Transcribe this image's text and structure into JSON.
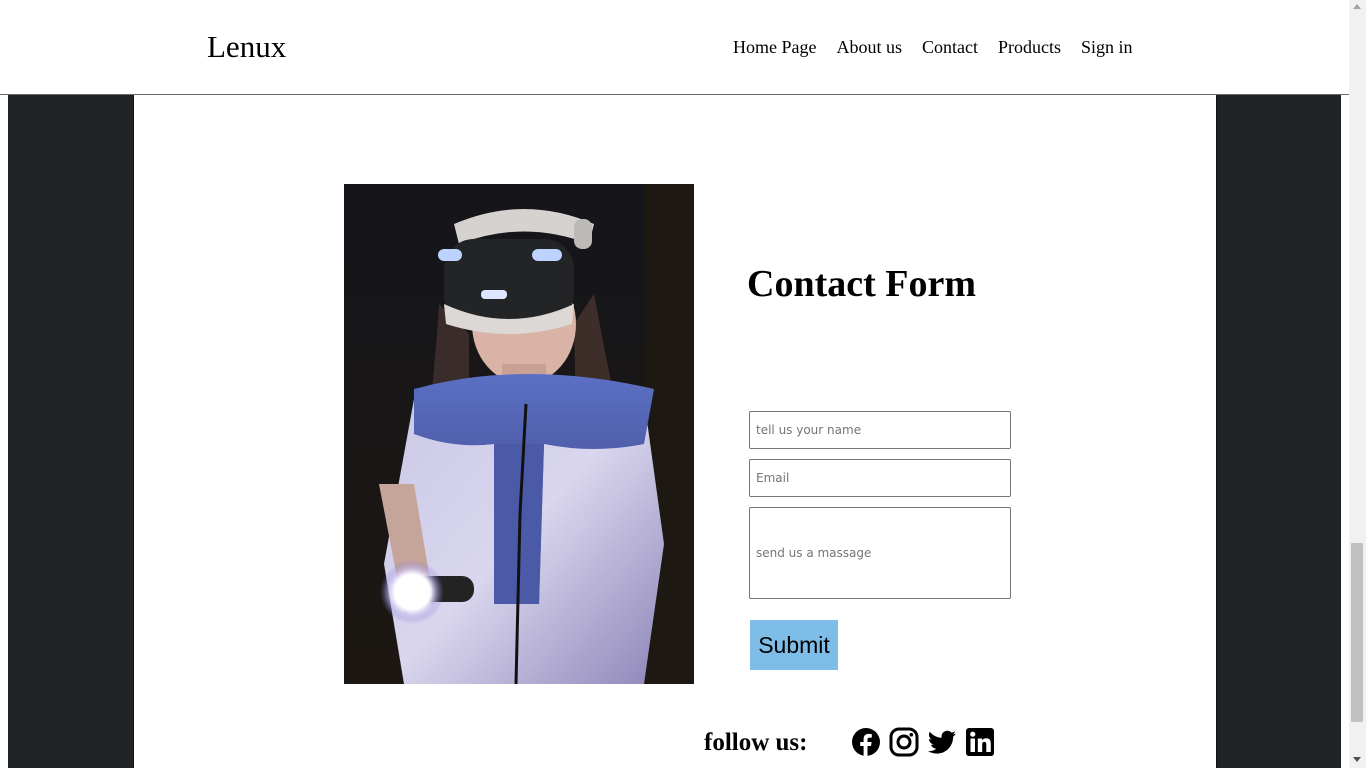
{
  "header": {
    "brand": "Lenux",
    "nav": [
      "Home Page",
      "About us",
      "Contact",
      "Products",
      "Sign in"
    ]
  },
  "contact": {
    "title": "Contact Form",
    "name_placeholder": "tell us your name",
    "email_placeholder": "Email",
    "message_placeholder": "send us a massage",
    "submit_label": "Submit"
  },
  "footer": {
    "follow_label": "follow us:",
    "socials": [
      "facebook-icon",
      "instagram-icon",
      "twitter-icon",
      "linkedin-icon"
    ]
  },
  "colors": {
    "dark_side": "#1f2326",
    "submit_bg": "#7dbde8"
  }
}
